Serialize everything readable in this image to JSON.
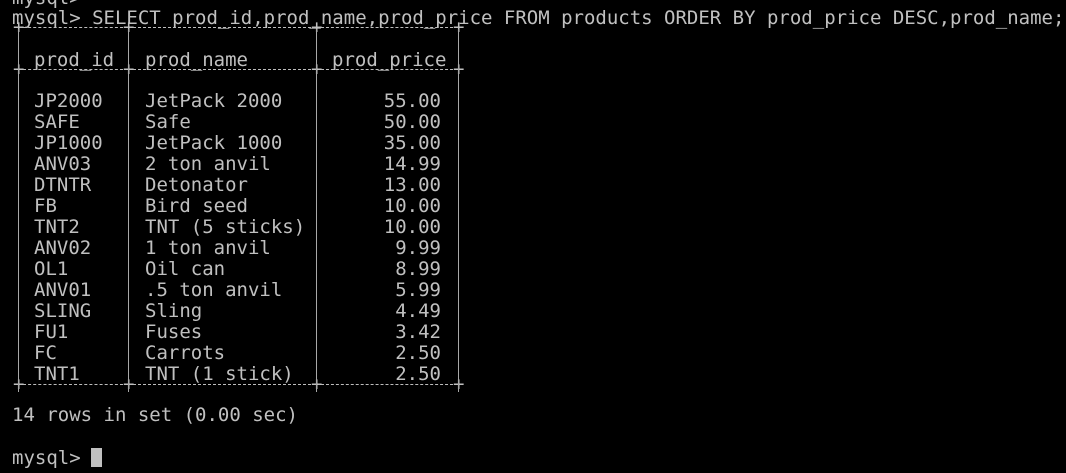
{
  "terminal": {
    "previous_prompt": "mysql>",
    "prompt": "mysql>",
    "query": "SELECT prod_id,prod_name,prod_price FROM products ORDER BY prod_price DESC,prod_name;",
    "summary": "14 rows in set (0.00 sec)"
  },
  "result_table": {
    "columns": [
      "prod_id",
      "prod_name",
      "prod_price"
    ],
    "rows": [
      [
        "JP2000",
        "JetPack 2000",
        "55.00"
      ],
      [
        "SAFE",
        "Safe",
        "50.00"
      ],
      [
        "JP1000",
        "JetPack 1000",
        "35.00"
      ],
      [
        "ANV03",
        "2 ton anvil",
        "14.99"
      ],
      [
        "DTNTR",
        "Detonator",
        "13.00"
      ],
      [
        "FB",
        "Bird seed",
        "10.00"
      ],
      [
        "TNT2",
        "TNT (5 sticks)",
        "10.00"
      ],
      [
        "ANV02",
        "1 ton anvil",
        "9.99"
      ],
      [
        "OL1",
        "Oil can",
        "8.99"
      ],
      [
        "ANV01",
        ".5 ton anvil",
        "5.99"
      ],
      [
        "SLING",
        "Sling",
        "4.49"
      ],
      [
        "FU1",
        "Fuses",
        "3.42"
      ],
      [
        "FC",
        "Carrots",
        "2.50"
      ],
      [
        "TNT1",
        "TNT (1 stick)",
        "2.50"
      ]
    ]
  },
  "colors": {
    "background": "#000000",
    "text": "#c0c0c0"
  }
}
